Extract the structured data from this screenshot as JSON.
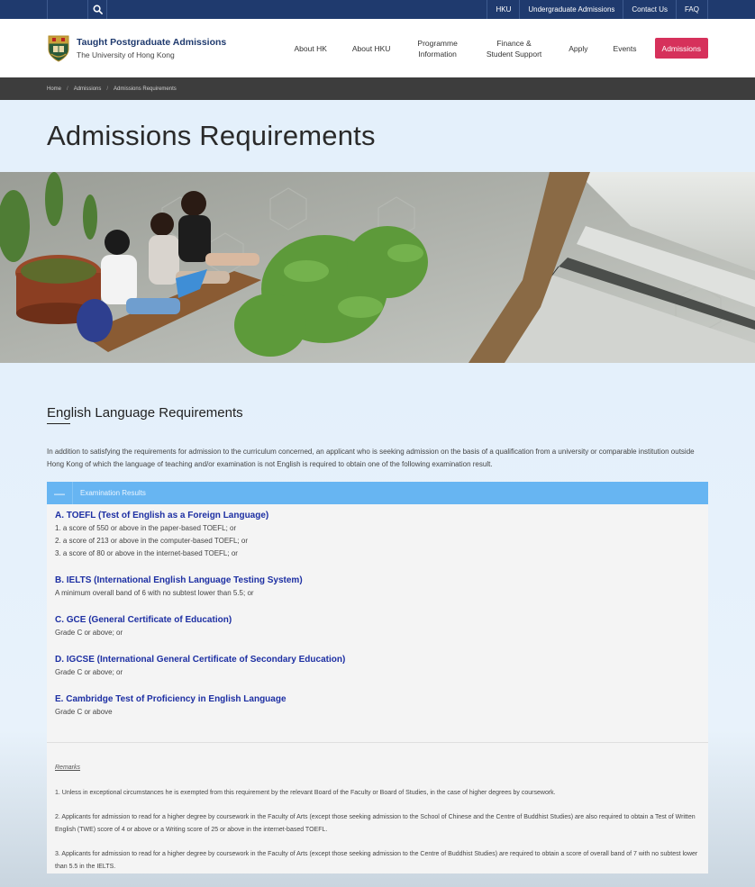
{
  "topbar": {
    "links": [
      "HKU",
      "Undergraduate Admissions",
      "Contact Us",
      "FAQ"
    ]
  },
  "header": {
    "title": "Taught Postgraduate Admissions",
    "subtitle": "The University of Hong Kong",
    "nav": [
      "About HK",
      "About HKU",
      "Programme\nInformation",
      "Finance &\nStudent Support",
      "Apply",
      "Events"
    ],
    "cta": "Admissions"
  },
  "breadcrumb": {
    "items": [
      "Home",
      "Admissions",
      "Admissions Requirements"
    ]
  },
  "page": {
    "title": "Admissions Requirements"
  },
  "section": {
    "title": "English Language Requirements",
    "intro": "In addition to satisfying the requirements for admission to the curriculum concerned, an applicant who is seeking admission on the basis of a qualification from a university or comparable institution outside Hong Kong of which the language of teaching and/or examination is not English is required to obtain one of the following examination result."
  },
  "panel": {
    "toggle": "—",
    "header": "Examination Results",
    "exams": [
      {
        "title": "A. TOEFL (Test of English as a Foreign Language)",
        "lines": [
          "1. a score of 550 or above in the paper-based TOEFL; or",
          "2. a score of 213 or above in the computer-based TOEFL; or",
          "3. a score of 80 or above in the internet-based TOEFL; or"
        ]
      },
      {
        "title": "B. IELTS (International English Language Testing System)",
        "lines": [
          "A minimum overall band of 6 with no subtest lower than 5.5; or"
        ]
      },
      {
        "title": "C. GCE (General Certificate of Education)",
        "lines": [
          "Grade C or above; or"
        ]
      },
      {
        "title": "D. IGCSE (International General Certificate of Secondary Education)",
        "lines": [
          "Grade C or above; or"
        ]
      },
      {
        "title": "E. Cambridge Test of Proficiency in English Language",
        "lines": [
          "Grade C or above"
        ]
      }
    ],
    "remarks_title": "Remarks",
    "remarks": [
      "1. Unless in exceptional circumstances he is exempted from this requirement by the relevant Board of the Faculty or Board of Studies, in the case of higher degrees by coursework.",
      "2. Applicants for admission to read for a higher degree by coursework in the Faculty of Arts (except those seeking admission to the School of Chinese and the Centre of Buddhist Studies) are also required to obtain a Test of Written English (TWE) score of 4 or above or a Writing score of 25 or above in the internet-based TOEFL.",
      "3. Applicants for admission to read for  a higher degree by coursework in the Faculty of Arts (except those seeking admission to the Centre of Buddhist Studies) are required to obtain a score of overall band of 7 with no subtest lower than 5.5 in the IELTS."
    ]
  }
}
